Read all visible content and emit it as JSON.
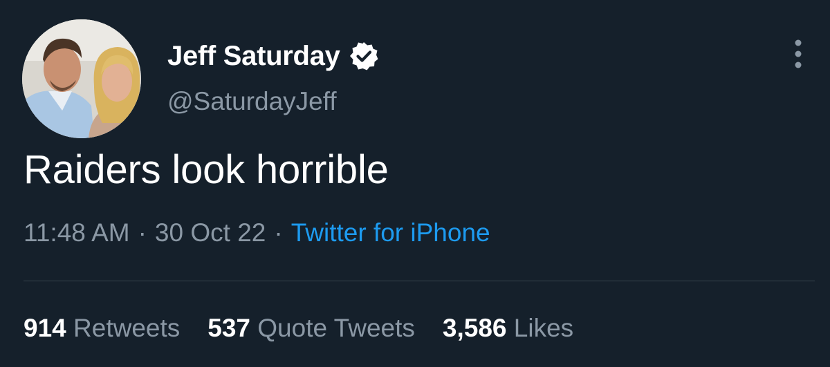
{
  "author": {
    "display_name": "Jeff Saturday",
    "handle": "@SaturdayJeff",
    "verified": true,
    "avatar_icon": "profile-photo-two-people"
  },
  "tweet": {
    "text": "Raiders look horrible",
    "time": "11:48 AM",
    "date": "30 Oct 22",
    "separator": "·",
    "source": "Twitter for iPhone"
  },
  "stats": {
    "retweets_count": "914",
    "retweets_label": "Retweets",
    "quotes_count": "537",
    "quotes_label": "Quote Tweets",
    "likes_count": "3,586",
    "likes_label": "Likes"
  },
  "icons": {
    "verified": "verified-badge-icon",
    "more": "more-options-icon"
  },
  "colors": {
    "background": "#15202b",
    "text_primary": "#ffffff",
    "text_secondary": "#8b98a5",
    "link": "#1d9bf0",
    "divider": "#38444d"
  }
}
